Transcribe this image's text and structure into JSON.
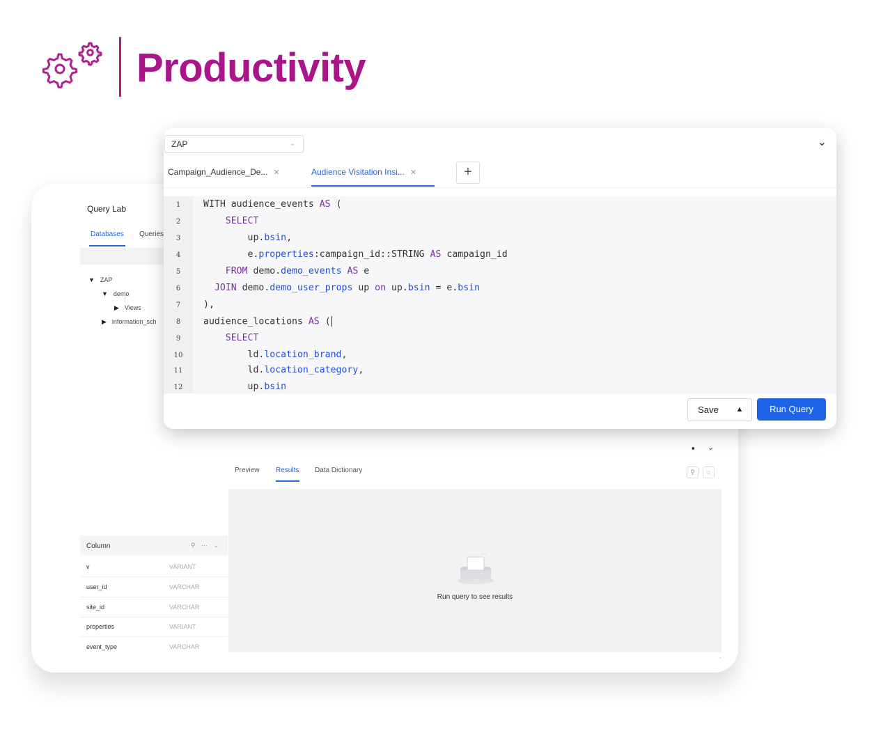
{
  "header": {
    "title": "Productivity",
    "icon": "gears-icon",
    "accent_color": "#a8168a"
  },
  "query_lab": {
    "title": "Query Lab",
    "tabs": [
      "Databases",
      "Queries"
    ],
    "active_tab": "Databases",
    "tree": [
      {
        "label": "ZAP",
        "depth": 0,
        "expanded": true
      },
      {
        "label": "demo",
        "depth": 1,
        "expanded": true
      },
      {
        "label": "Views",
        "depth": 2,
        "expanded": false
      },
      {
        "label": "information_sch",
        "depth": 1,
        "expanded": false
      }
    ],
    "columns_header": "Column",
    "columns": [
      {
        "name": "v",
        "type": "VARIANT"
      },
      {
        "name": "user_id",
        "type": "VARCHAR"
      },
      {
        "name": "site_id",
        "type": "VARCHAR"
      },
      {
        "name": "properties",
        "type": "VARIANT"
      },
      {
        "name": "event_type",
        "type": "VARCHAR"
      }
    ]
  },
  "results": {
    "tabs": [
      "Preview",
      "Results",
      "Data Dictionary"
    ],
    "active_tab": "Results",
    "empty_message": "Run query to see results"
  },
  "editor": {
    "database": "ZAP",
    "tabs": [
      {
        "label": "Campaign_Audience_De...",
        "active": false
      },
      {
        "label": "Audience Visitation Insi...",
        "active": true
      }
    ],
    "add_tab_label": "+",
    "line_numbers": [
      "1",
      "2",
      "3",
      "4",
      "5",
      "6",
      "7",
      "8",
      "9",
      "10",
      "11",
      "12"
    ],
    "save_label": "Save",
    "run_label": "Run Query",
    "accent_color": "#1e63e8"
  }
}
